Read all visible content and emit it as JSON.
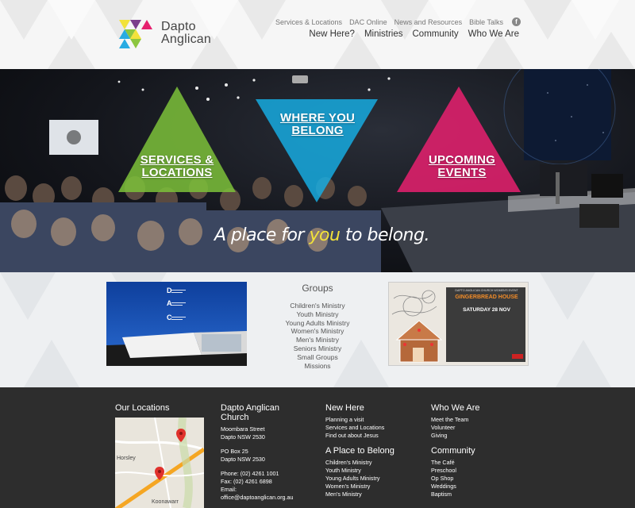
{
  "brand": {
    "name_line1": "Dapto",
    "name_line2": "Anglican",
    "colors": {
      "green": "#8cc63f",
      "cyan": "#29abe2",
      "magenta": "#e6206f",
      "yellow": "#f2e23a",
      "purple": "#7b3f8c"
    }
  },
  "top_nav": [
    "Services & Locations",
    "DAC Online",
    "News and Resources",
    "Bible Talks"
  ],
  "social": {
    "facebook_glyph": "f"
  },
  "main_nav": [
    "New Here?",
    "Ministries",
    "Community",
    "Who We Are"
  ],
  "hero": {
    "services": {
      "line1": "SERVICES &",
      "line2": "LOCATIONS"
    },
    "where": {
      "line1": "WHERE YOU",
      "line2": "BELONG"
    },
    "events": {
      "line1": "UPCOMING",
      "line2": "EVENTS"
    },
    "tagline": {
      "part1": "A place for ",
      "highlight": "you",
      "part2": " to belong."
    }
  },
  "dac_card": {
    "letters": [
      "D",
      "A",
      "C"
    ]
  },
  "groups": {
    "title": "Groups",
    "items": [
      "Children's Ministry",
      "Youth Ministry",
      "Young Adults Ministry",
      "Women's Ministry",
      "Men's Ministry",
      "Seniors Ministry",
      "Small Groups",
      "Missions"
    ]
  },
  "gingerbread": {
    "org": "DAPTO ANGLICAN CHURCH WOMEN'S EVENT",
    "title": "GINGERBREAD HOUSE",
    "date": "SATURDAY 28 NOV"
  },
  "footer": {
    "locations": {
      "title": "Our Locations"
    },
    "church": {
      "title1": "Dapto Anglican",
      "title2": "Church",
      "street": "Moombara Street",
      "suburb": "Dapto NSW 2530",
      "pobox": "PO Box 25",
      "pobox_suburb": "Dapto NSW 2530",
      "phone": "Phone: (02) 4261 1001",
      "fax": "Fax: (02) 4261 6898",
      "email_label": "Email:",
      "email": "office@daptoanglican.org.au"
    },
    "new_here": {
      "title": "New Here",
      "links": [
        "Planning a visit",
        "Services and Locations",
        "Find out about Jesus"
      ],
      "belong_title": "A Place to Belong",
      "belong_links": [
        "Children's Ministry",
        "Youth Ministry",
        "Young Adults Ministry",
        "Women's Ministry",
        "Men's Ministry"
      ]
    },
    "who_we_are": {
      "title": "Who We Are",
      "links": [
        "Meet the Team",
        "Volunteer",
        "Giving"
      ],
      "community_title": "Community",
      "community_links": [
        "The Café",
        "Preschool",
        "Op Shop",
        "Weddings",
        "Baptism"
      ]
    },
    "map": {
      "labels": [
        "Horsley",
        "Koonawarr"
      ]
    }
  }
}
